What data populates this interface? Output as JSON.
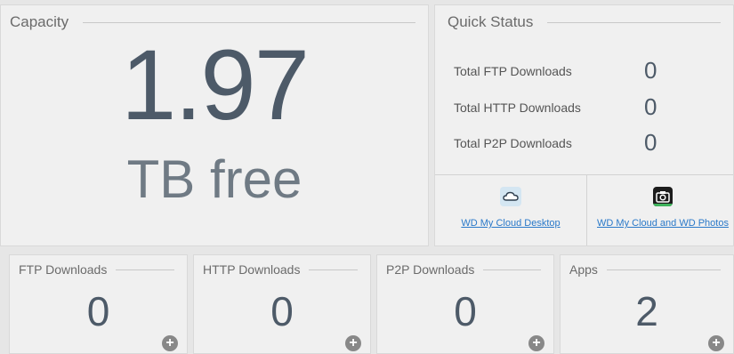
{
  "capacity": {
    "title": "Capacity",
    "value": "1.97",
    "unit": "TB free"
  },
  "quick_status": {
    "title": "Quick Status",
    "rows": [
      {
        "label": "Total FTP Downloads",
        "value": "0"
      },
      {
        "label": "Total HTTP Downloads",
        "value": "0"
      },
      {
        "label": "Total P2P Downloads",
        "value": "0"
      }
    ],
    "links": [
      {
        "label": "WD My Cloud Desktop",
        "icon": "cloud-icon"
      },
      {
        "label": "WD My Cloud and WD Photos",
        "icon": "camera-icon"
      }
    ]
  },
  "tiles": [
    {
      "title": "FTP Downloads",
      "value": "0"
    },
    {
      "title": "HTTP Downloads",
      "value": "0"
    },
    {
      "title": "P2P Downloads",
      "value": "0"
    },
    {
      "title": "Apps",
      "value": "2"
    }
  ],
  "colors": {
    "accent_number": "#4d5a68",
    "link": "#2a79c9",
    "panel_bg": "#f0f0f0"
  }
}
